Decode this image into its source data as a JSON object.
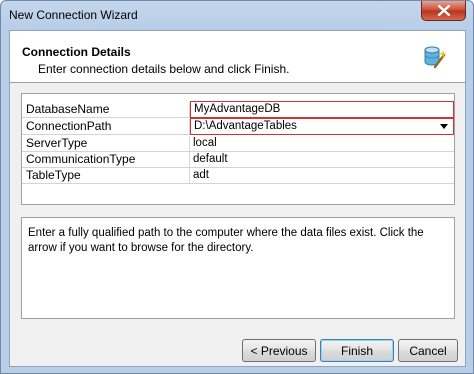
{
  "window": {
    "title": "New Connection Wizard"
  },
  "header": {
    "title": "Connection Details",
    "subtitle": "Enter connection details below and click Finish."
  },
  "properties": [
    {
      "name": "DatabaseName",
      "value": "MyAdvantageDB",
      "editing": true
    },
    {
      "name": "ConnectionPath",
      "value": "D:\\AdvantageTables",
      "editing": true,
      "dropdown": true
    },
    {
      "name": "ServerType",
      "value": "local"
    },
    {
      "name": "CommunicationType",
      "value": "default"
    },
    {
      "name": "TableType",
      "value": "adt"
    }
  ],
  "description": "Enter a fully qualified path to the computer where the data files exist. Click the arrow if you want to browse for the directory.",
  "buttons": {
    "previous": "< Previous",
    "finish": "Finish",
    "cancel": "Cancel"
  },
  "colors": {
    "edit_border": "#d13232",
    "close_button": "#c74a32"
  },
  "icons": {
    "header": "database-wand-icon",
    "close": "close-icon",
    "dropdown": "chevron-down-icon"
  }
}
